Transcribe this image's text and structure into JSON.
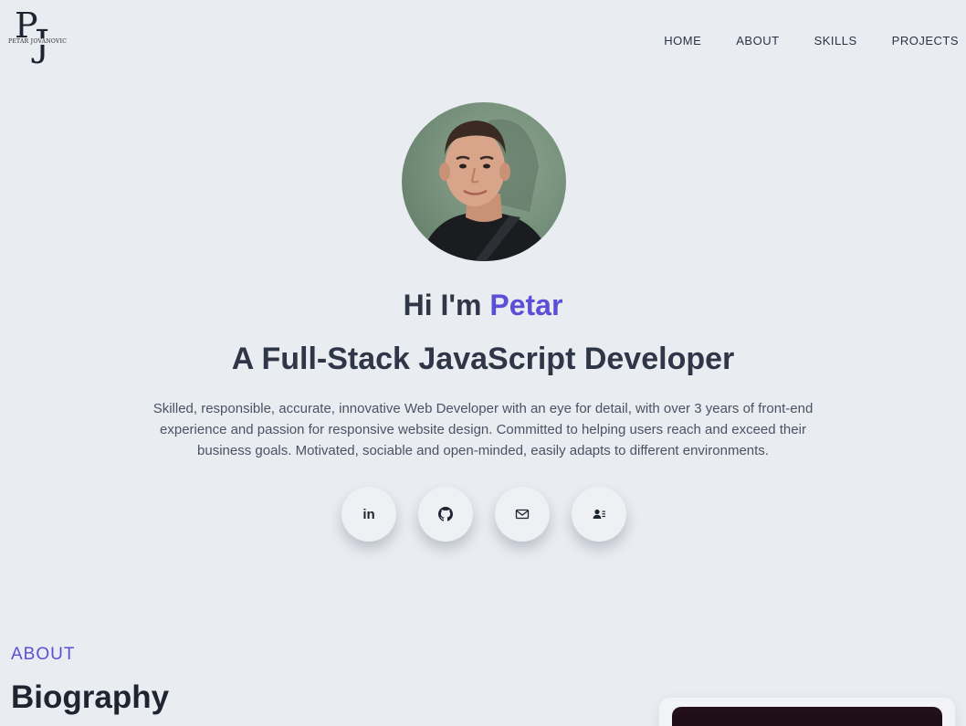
{
  "logo": {
    "monogram_p": "P",
    "monogram_j": "J",
    "name": "PETAR JOVANOVIC"
  },
  "nav": {
    "items": [
      {
        "label": "HOME"
      },
      {
        "label": "ABOUT"
      },
      {
        "label": "SKILLS"
      },
      {
        "label": "PROJECTS"
      }
    ]
  },
  "hero": {
    "greeting_prefix": "Hi I'm",
    "greeting_name": "Petar",
    "headline": "A Full-Stack JavaScript Developer",
    "intro": "Skilled, responsible, accurate, innovative Web Developer with an eye for detail, with over 3 years of front-end experience and passion for responsive website design. Committed to helping users reach and exceed their business goals. Motivated, sociable and open-minded, easily adapts to different environments.",
    "socials": [
      {
        "icon": "linkedin-icon",
        "glyph": "in"
      },
      {
        "icon": "github-icon"
      },
      {
        "icon": "mail-icon"
      },
      {
        "icon": "contact-card-icon"
      }
    ]
  },
  "about": {
    "kicker": "ABOUT",
    "title": "Biography"
  },
  "colors": {
    "background": "#e9ecf1",
    "accent": "#5a4fd6",
    "text": "#2f3647"
  }
}
